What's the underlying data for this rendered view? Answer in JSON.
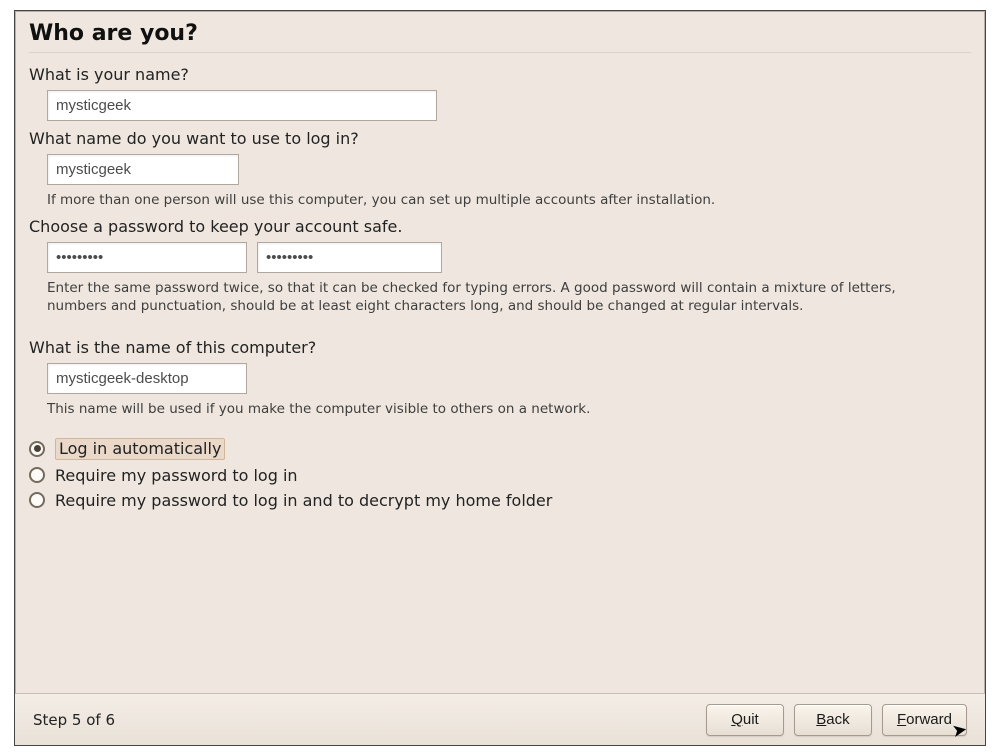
{
  "title": "Who are you?",
  "name_section": {
    "question": "What is your name?",
    "value": "mysticgeek"
  },
  "login_section": {
    "question": "What name do you want to use to log in?",
    "value": "mysticgeek",
    "hint": "If more than one person will use this computer, you can set up multiple accounts after installation."
  },
  "password_section": {
    "question": "Choose a password to keep your account safe.",
    "value1": "•••••••••",
    "value2": "•••••••••",
    "hint": "Enter the same password twice, so that it can be checked for typing errors. A good password will contain a mixture of letters, numbers and punctuation, should be at least eight characters long, and should be changed at regular intervals."
  },
  "hostname_section": {
    "question": "What is the name of this computer?",
    "value": "mysticgeek-desktop",
    "hint": "This name will be used if you make the computer visible to others on a network."
  },
  "login_options": {
    "auto": "Log in automatically",
    "require": "Require my password to log in",
    "decrypt": "Require my password to log in and to decrypt my home folder",
    "selected": "auto"
  },
  "footer": {
    "step": "Step 5 of 6",
    "quit": "Quit",
    "back": "Back",
    "forward": "Forward"
  }
}
